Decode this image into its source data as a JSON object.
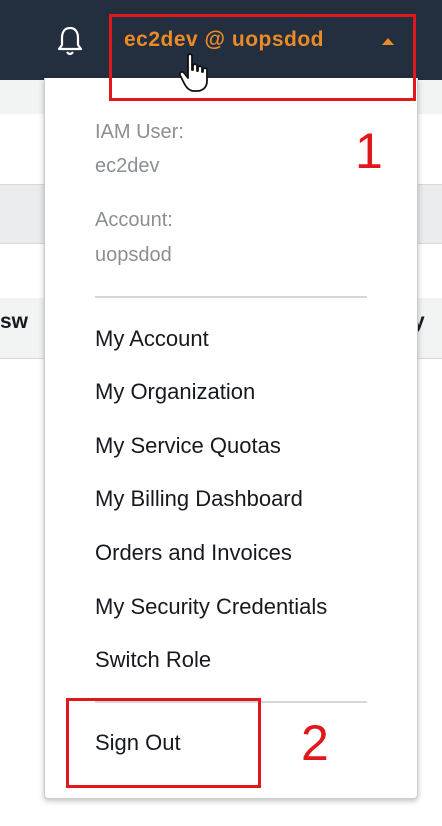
{
  "topbar": {
    "notification_icon": "bell-icon",
    "account_label": "ec2dev @ uopsdod",
    "caret_icon": "caret-up-icon",
    "accent_color": "#ec8a26",
    "background_color": "#232f3e"
  },
  "dropdown": {
    "iam_user_label": "IAM User:",
    "iam_user_value": "ec2dev",
    "account_label": "Account:",
    "account_value": "uopsdod",
    "items": [
      {
        "label": "My Account"
      },
      {
        "label": "My Organization"
      },
      {
        "label": "My Service Quotas"
      },
      {
        "label": "My Billing Dashboard"
      },
      {
        "label": "Orders and Invoices"
      },
      {
        "label": "My Security Credentials"
      },
      {
        "label": "Switch Role"
      }
    ],
    "sign_out_label": "Sign Out"
  },
  "background": {
    "left_fragment": "sw",
    "right_fragment": "y"
  },
  "annotations": {
    "label_1": "1",
    "label_2": "2",
    "color": "#e0171b"
  }
}
